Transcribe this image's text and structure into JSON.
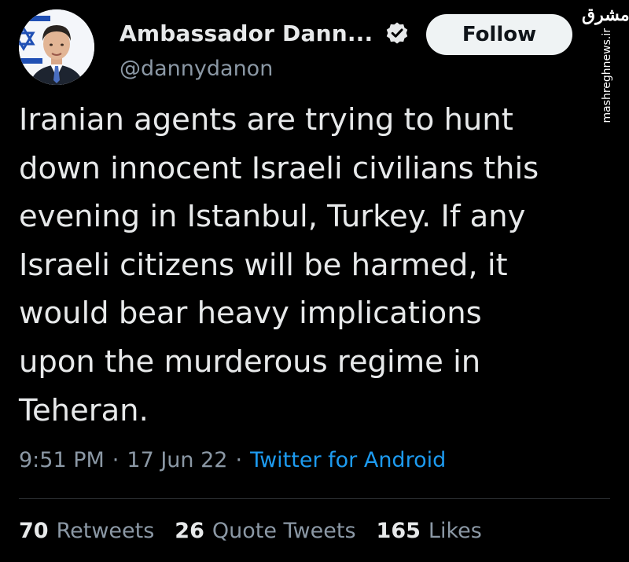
{
  "author": {
    "display_name": "Ambassador Dann...",
    "handle": "@dannydanon",
    "verified": true,
    "avatar_icon": "profile-photo-with-israeli-flag"
  },
  "actions": {
    "follow_label": "Follow"
  },
  "tweet": {
    "text": "Iranian agents are trying to hunt\ndown innocent Israeli civilians this\nevening in Istanbul, Turkey. If any\nIsraeli citizens will be harmed, it\nwould bear heavy implications\nupon the murderous regime in\nTeheran.",
    "time": "9:51 PM",
    "separator": "·",
    "date": "17 Jun 22",
    "source": "Twitter for Android"
  },
  "stats": {
    "retweets_count": "70",
    "retweets_label": "Retweets",
    "quotes_count": "26",
    "quotes_label": "Quote Tweets",
    "likes_count": "165",
    "likes_label": "Likes"
  },
  "watermark": {
    "logo": "مشرق",
    "site": "mashreghnews.ir"
  },
  "colors": {
    "background": "#000000",
    "primary_text": "#e7e9ea",
    "secondary_text": "#8b98a5",
    "link": "#1d9bf0",
    "follow_bg": "#eff3f4",
    "divider": "#2f3336"
  }
}
